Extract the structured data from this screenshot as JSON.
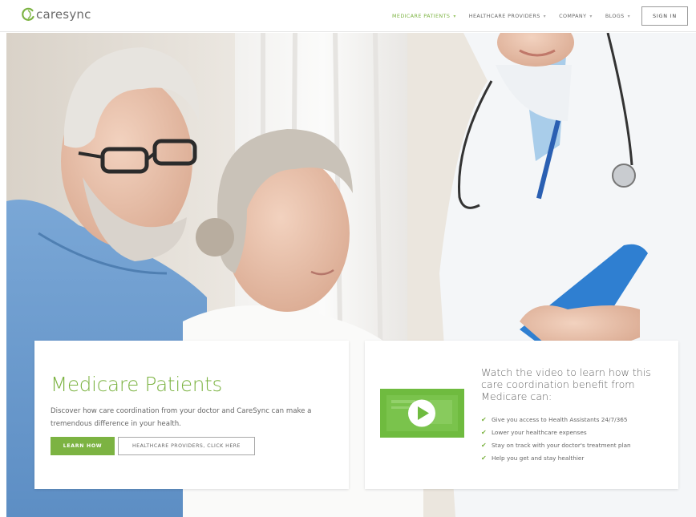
{
  "brand": {
    "name": "caresync",
    "logo_icon": "caresync-logo-icon"
  },
  "nav": {
    "items": [
      {
        "label": "MEDICARE PATIENTS",
        "active": true
      },
      {
        "label": "HEALTHCARE PROVIDERS",
        "active": false
      },
      {
        "label": "COMPANY",
        "active": false
      },
      {
        "label": "BLOGS",
        "active": false
      }
    ],
    "chevron": "▾",
    "signin": "SIGN IN"
  },
  "hero": {
    "image": "photo of elderly couple with doctor holding tablet"
  },
  "patients_card": {
    "title": "Medicare Patients",
    "description": "Discover how care coordination from your doctor and CareSync can make a tremendous difference in your health.",
    "learn_button": "LEARN HOW",
    "providers_button": "HEALTHCARE PROVIDERS, CLICK HERE"
  },
  "video_card": {
    "title": "Watch the video to learn how this care coordination benefit from Medicare can:",
    "bullets": [
      "Give you access to Health Assistants 24/7/365",
      "Lower your healthcare expenses",
      "Stay on track with your doctor's treatment plan",
      "Help you get and stay healthier"
    ],
    "check_icon": "✔"
  },
  "colors": {
    "accent": "#7cb342",
    "text": "#666666",
    "border": "#a8a8a8"
  }
}
